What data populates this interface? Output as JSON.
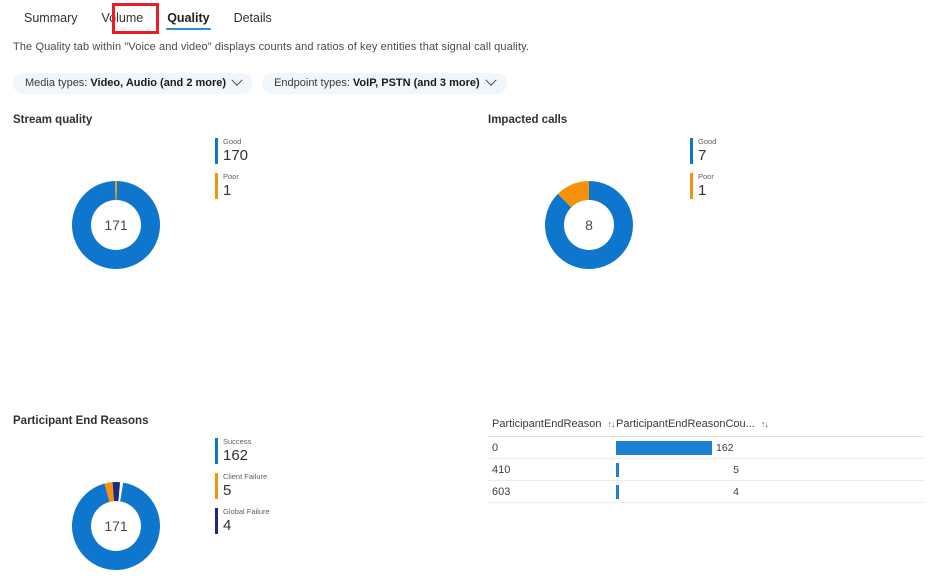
{
  "tabs": [
    {
      "label": "Summary",
      "selected": false
    },
    {
      "label": "Volume",
      "selected": false
    },
    {
      "label": "Quality",
      "selected": true
    },
    {
      "label": "Details",
      "selected": false
    }
  ],
  "description": "The Quality tab within \"Voice and video\" displays counts and ratios of key entities that signal call quality.",
  "filters": [
    {
      "label": "Media types:",
      "value": "Video, Audio (and 2 more)",
      "icon": "chevron-down-icon"
    },
    {
      "label": "Endpoint types:",
      "value": "VoIP, PSTN (and 3 more)",
      "icon": "chevron-down-icon"
    }
  ],
  "colors": {
    "blue": "#0f76ce",
    "orange": "#f7900a",
    "navy": "#1a2a80",
    "accent_red": "#ec1c24",
    "tab_underline": "#2a8ae0",
    "pill_bg": "#eff6fc",
    "bar_blue": "#1b7fd4"
  },
  "sections": {
    "stream_quality": {
      "title": "Stream quality",
      "center_total": "171"
    },
    "impacted_calls": {
      "title": "Impacted calls",
      "center_total": "8"
    },
    "participant_end_reasons": {
      "title": "Participant End Reasons",
      "center_total": "171"
    }
  },
  "table": {
    "headers": [
      {
        "label": "ParticipantEndReason",
        "sort": "↑↓"
      },
      {
        "label": "ParticipantEndReasonCou...",
        "sort": "↑↓"
      }
    ],
    "rows": [
      {
        "key": "0",
        "value": "162"
      },
      {
        "key": "410",
        "value": "5"
      },
      {
        "key": "603",
        "value": "4"
      }
    ]
  },
  "chart_data": [
    {
      "type": "pie",
      "title": "Stream quality",
      "categories": [
        "Good",
        "Poor"
      ],
      "values": [
        170,
        1
      ],
      "colors": [
        "#0f76ce",
        "#f7900a"
      ],
      "total": 171,
      "center_label": "171",
      "legend": "right",
      "donut": true
    },
    {
      "type": "pie",
      "title": "Impacted calls",
      "categories": [
        "Good",
        "Poor"
      ],
      "values": [
        7,
        1
      ],
      "colors": [
        "#0f76ce",
        "#f7900a"
      ],
      "total": 8,
      "center_label": "8",
      "legend": "right",
      "donut": true
    },
    {
      "type": "pie",
      "title": "Participant End Reasons",
      "categories": [
        "Success",
        "Client Failure",
        "Global Failure"
      ],
      "values": [
        162,
        5,
        4
      ],
      "colors": [
        "#0f76ce",
        "#f7900a",
        "#1a2a80"
      ],
      "total": 171,
      "center_label": "171",
      "legend": "right",
      "donut": true
    },
    {
      "type": "bar",
      "title": "ParticipantEndReason counts",
      "orientation": "horizontal",
      "categories": [
        "0",
        "410",
        "603"
      ],
      "values": [
        162,
        5,
        4
      ],
      "xlabel": "ParticipantEndReasonCou...",
      "ylabel": "ParticipantEndReason",
      "xlim": [
        0,
        162
      ],
      "grid": false,
      "colors": [
        "#1b7fd4"
      ]
    }
  ]
}
